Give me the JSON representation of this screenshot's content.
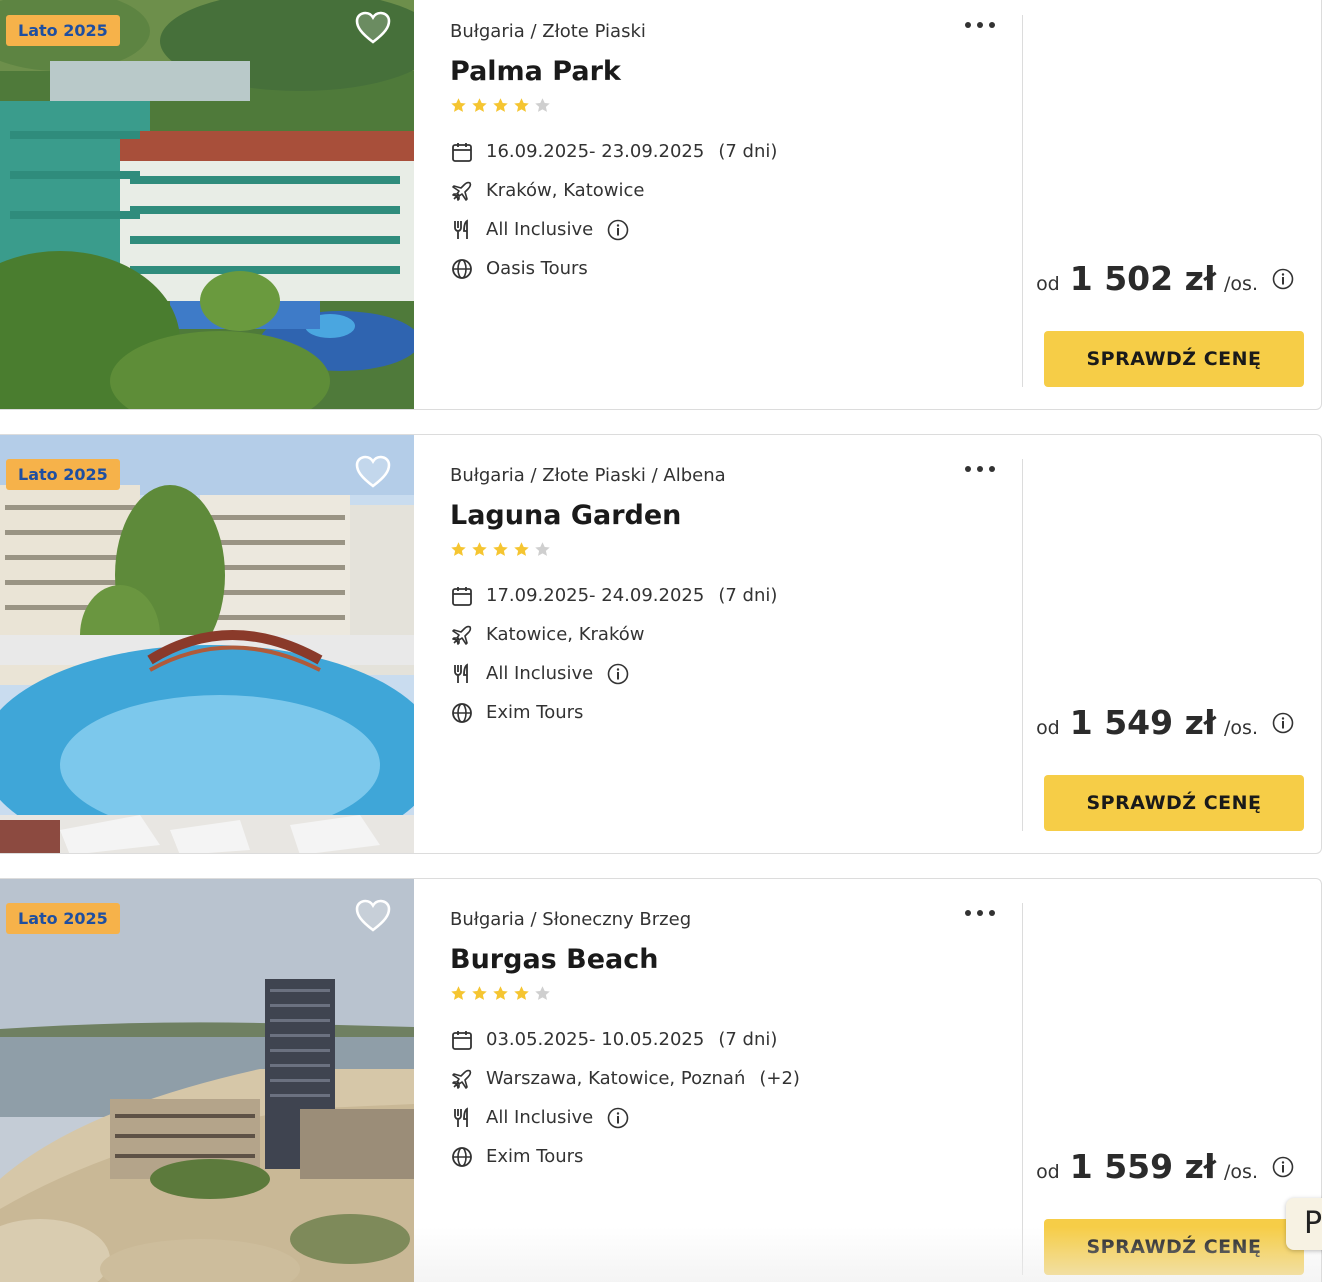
{
  "offers": [
    {
      "badge": "Lato 2025",
      "breadcrumb": "Bułgaria / Złote Piaski",
      "title": "Palma Park",
      "stars": 4,
      "stars_max": 5,
      "dates": "16.09.2025- 23.09.2025",
      "duration": "(7 dni)",
      "departures": "Kraków, Katowice",
      "departures_extra": "",
      "board": "All Inclusive",
      "operator": "Oasis Tours",
      "price_prefix": "od",
      "price": "1 502 zł",
      "price_suffix": "/os.",
      "button": "SPRAWDŹ CENĘ",
      "photo": "hotel-aerial-scene"
    },
    {
      "badge": "Lato 2025",
      "breadcrumb": "Bułgaria / Złote Piaski / Albena",
      "title": "Laguna Garden",
      "stars": 4,
      "stars_max": 5,
      "dates": "17.09.2025- 24.09.2025",
      "duration": "(7 dni)",
      "departures": "Katowice, Kraków",
      "departures_extra": "",
      "board": "All Inclusive",
      "operator": "Exim Tours",
      "price_prefix": "od",
      "price": "1 549 zł",
      "price_suffix": "/os.",
      "button": "SPRAWDŹ CENĘ",
      "photo": "pool-scene"
    },
    {
      "badge": "Lato 2025",
      "breadcrumb": "Bułgaria / Słoneczny Brzeg",
      "title": "Burgas Beach",
      "stars": 4,
      "stars_max": 5,
      "dates": "03.05.2025- 10.05.2025",
      "duration": "(7 dni)",
      "departures": "Warszawa, Katowice, Poznań",
      "departures_extra": "(+2)",
      "board": "All Inclusive",
      "operator": "Exim Tours",
      "price_prefix": "od",
      "price": "1 559 zł",
      "price_suffix": "/os.",
      "button": "SPRAWDŹ CENĘ",
      "photo": "beach-tower-scene"
    }
  ],
  "floating_button": "P",
  "colors": {
    "badge_bg": "#f6b24a",
    "badge_text": "#1f4fa0",
    "star_on": "#f5c531",
    "star_off": "#cfcfcf",
    "button_bg": "#f6cd47"
  },
  "icons": {
    "calendar": "calendar-icon",
    "plane": "plane-icon",
    "board": "cutlery-icon",
    "operator": "globe-icon",
    "info": "info-icon",
    "favorite": "heart-icon",
    "menu": "more-dots-icon"
  }
}
